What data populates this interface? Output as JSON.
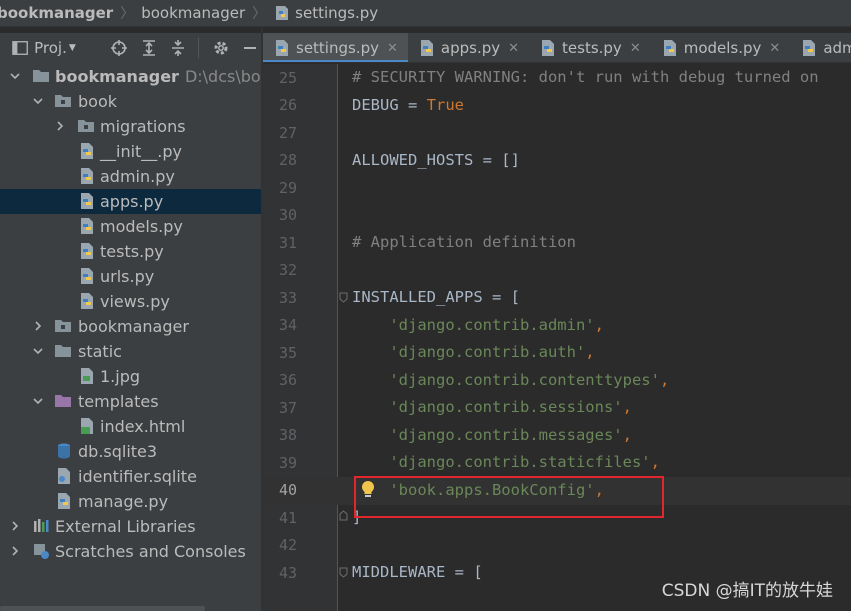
{
  "breadcrumb": {
    "project": "bookmanager",
    "folder": "bookmanager",
    "file": "settings.py"
  },
  "project_toolbar": {
    "view_label": "Proj.",
    "icons": [
      "locate-icon",
      "expand-all-icon",
      "collapse-all-icon",
      "gear-icon",
      "minimize-icon"
    ]
  },
  "tree": {
    "root": {
      "name": "bookmanager",
      "path": "D:\\dcs\\book"
    },
    "book": "book",
    "migrations": "migrations",
    "init": "__init__.py",
    "admin": "admin.py",
    "apps": "apps.py",
    "models": "models.py",
    "tests": "tests.py",
    "urls": "urls.py",
    "views": "views.py",
    "bookmanager_pkg": "bookmanager",
    "static": "static",
    "jpg": "1.jpg",
    "templates": "templates",
    "index": "index.html",
    "db": "db.sqlite3",
    "identifier": "identifier.sqlite",
    "manage": "manage.py",
    "external": "External Libraries",
    "scratches": "Scratches and Consoles"
  },
  "tabs": [
    {
      "label": "settings.py",
      "active": true
    },
    {
      "label": "apps.py",
      "active": false
    },
    {
      "label": "tests.py",
      "active": false
    },
    {
      "label": "models.py",
      "active": false
    },
    {
      "label": "adm",
      "active": false
    }
  ],
  "editor": {
    "current_line": "40",
    "lines": [
      {
        "n": "25",
        "text": "# SECURITY WARNING: don't run with debug turned on"
      },
      {
        "n": "26",
        "a": "DEBUG = ",
        "b": "True"
      },
      {
        "n": "27",
        "text": ""
      },
      {
        "n": "28",
        "text": "ALLOWED_HOSTS = []"
      },
      {
        "n": "29",
        "text": ""
      },
      {
        "n": "30",
        "text": ""
      },
      {
        "n": "31",
        "text": "# Application definition"
      },
      {
        "n": "32",
        "text": ""
      },
      {
        "n": "33",
        "text": "INSTALLED_APPS = ["
      },
      {
        "n": "34",
        "s": "    'django.contrib.admin'",
        "p": ","
      },
      {
        "n": "35",
        "s": "    'django.contrib.auth'",
        "p": ","
      },
      {
        "n": "36",
        "s": "    'django.contrib.contenttypes'",
        "p": ","
      },
      {
        "n": "37",
        "s": "    'django.contrib.sessions'",
        "p": ","
      },
      {
        "n": "38",
        "s": "    'django.contrib.messages'",
        "p": ","
      },
      {
        "n": "39",
        "s": "    'django.contrib.staticfiles'",
        "p": ","
      },
      {
        "n": "40",
        "s": "    'book.apps.BookConfig'",
        "p": ","
      },
      {
        "n": "41",
        "text": "]"
      },
      {
        "n": "42",
        "text": ""
      },
      {
        "n": "43",
        "text": "MIDDLEWARE = ["
      }
    ]
  },
  "watermark": "CSDN @搞IT的放牛娃",
  "colors": {
    "keyword": "#cc7832",
    "string": "#6a8759",
    "comment": "#808080",
    "selection": "#0d293e",
    "annotation_box": "#e3262c"
  }
}
